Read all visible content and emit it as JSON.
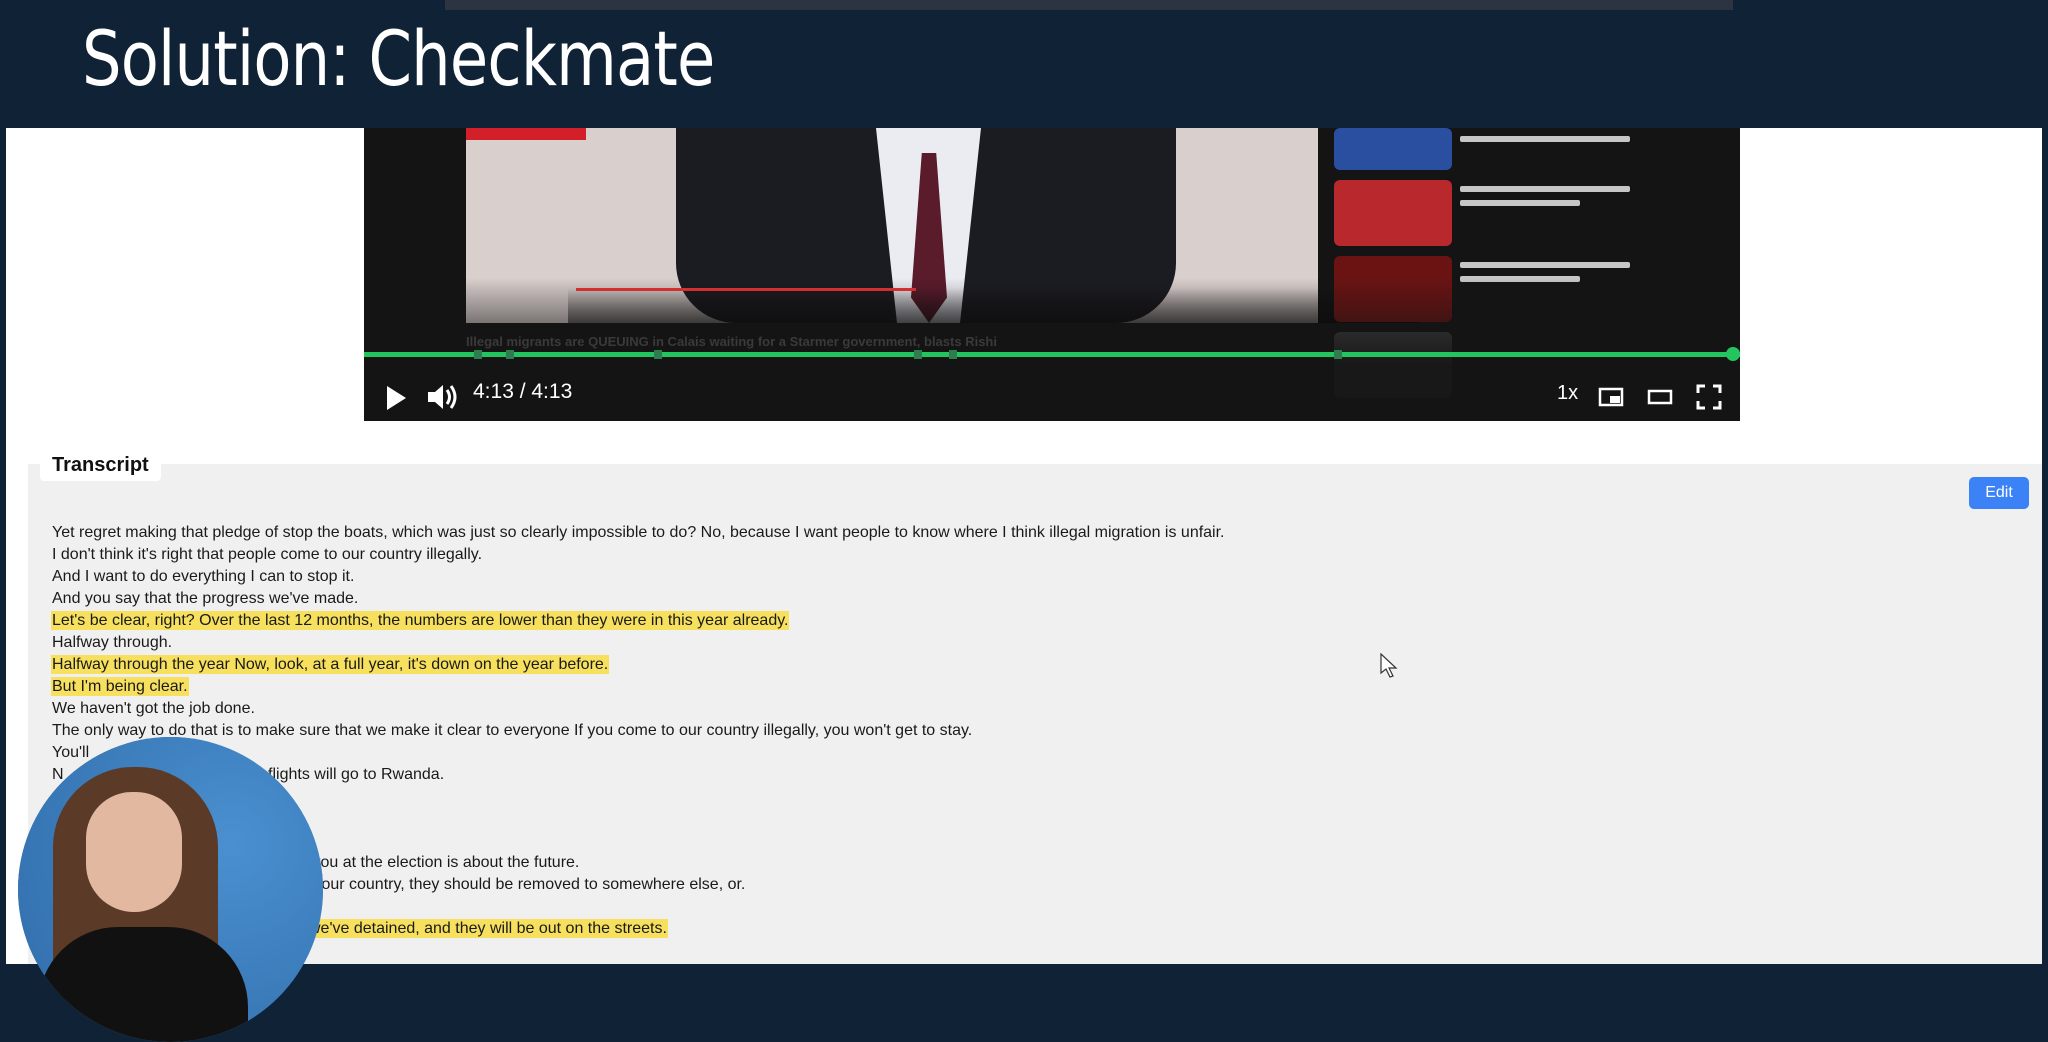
{
  "slide": {
    "title": "Solution: Checkmate"
  },
  "video": {
    "caption": "Illegal migrants are QUEUING in Calais waiting for a Starmer government, blasts Rishi",
    "time": "4:13 / 4:13",
    "speed": "1x",
    "progress_fraction": 1.0
  },
  "transcript": {
    "tab_label": "Transcript",
    "edit_label": "Edit",
    "lines": [
      {
        "text": "Yet regret making that pledge of stop the boats, which was just so clearly impossible to do? No, because I want people to know where I think illegal migration is unfair.",
        "highlighted": false
      },
      {
        "text": "I don't think it's right that people come to our country illegally.",
        "highlighted": false
      },
      {
        "text": "And I want to do everything I can to stop it.",
        "highlighted": false
      },
      {
        "text": "And you say that the progress we've made.",
        "highlighted": false
      },
      {
        "text": "Let's be clear, right? Over the last 12 months, the numbers are lower than they were in this year already.",
        "highlighted": true
      },
      {
        "text": "Halfway through.",
        "highlighted": false
      },
      {
        "text": "Halfway through the year Now, look, at a full year, it's down on the year before.",
        "highlighted": true
      },
      {
        "text": "But I'm being clear.",
        "highlighted": true
      },
      {
        "text": "We haven't got the job done.",
        "highlighted": false
      },
      {
        "text": "The only way to do that is to make sure that we make it clear to everyone If you come to our country illegally, you won't get to stay.",
        "highlighted": false
      },
      {
        "text": "You'll",
        "highlighted": false
      },
      {
        "text": "N                                        the flights will go to Rwanda.",
        "highlighted": false
      },
      {
        "text": "",
        "highlighted": false
      },
      {
        "text": "",
        "highlighted": false
      },
      {
        "text": "",
        "highlighted": false
      },
      {
        "text": "                                        ce for all of you at the election is about the future.",
        "highlighted": false
      },
      {
        "text": "                                        uld not be in our country, they should be removed to somewhere else, or.",
        "highlighted": false
      },
      {
        "text": "",
        "highlighted": false
      },
      {
        "text": "                                        the people we've detained, and they will be out on the streets.",
        "highlighted": true
      }
    ]
  },
  "colors": {
    "accent": "#3b82f6",
    "highlight": "#f6e05e",
    "progress": "#22c55e",
    "slide_bg": "#0f2236"
  },
  "icons": [
    "play-icon",
    "volume-icon",
    "miniplayer-icon",
    "theater-icon",
    "fullscreen-icon",
    "cursor-icon"
  ]
}
